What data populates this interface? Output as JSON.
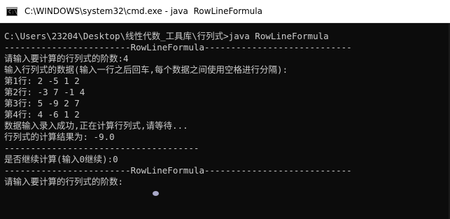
{
  "window": {
    "title": "C:\\WINDOWS\\system32\\cmd.exe - java  RowLineFormula",
    "icon_label": "C:\\"
  },
  "console": {
    "lines": [
      "C:\\Users\\23204\\Desktop\\线性代数_工具库\\行列式>java RowLineFormula",
      "------------------------RowLineFormula----------------------------",
      "请输入要计算的行列式的阶数:4",
      "输入行列式的数据(输入一行之后回车,每个数据之间使用空格进行分隔):",
      "第1行: 2 -5 1 2",
      "第2行: -3 7 -1 4",
      "第3行: 5 -9 2 7",
      "第4行: 4 -6 1 2",
      "数据输入录入成功,正在计算行列式,请等待...",
      "行列式的计算结果为: -9.0",
      "-------------------------------------",
      "是否继续计算(输入0继续):0",
      "------------------------RowLineFormula----------------------------",
      "请输入要计算的行列式的阶数:"
    ]
  },
  "colors": {
    "console_bg": "#0c0c0c",
    "console_text": "#cccccc",
    "titlebar_bg": "#ffffff"
  }
}
